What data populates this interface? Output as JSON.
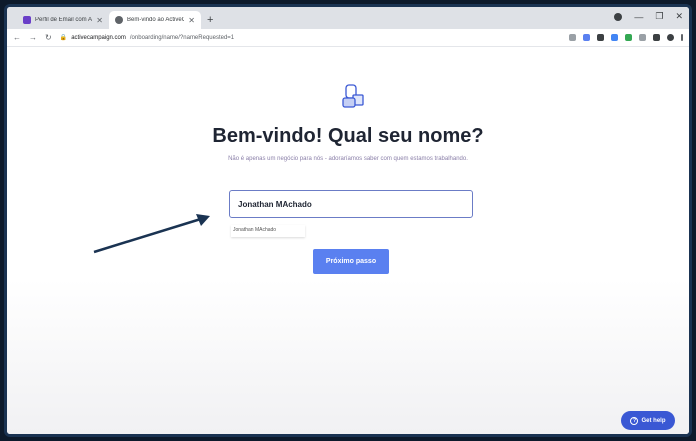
{
  "browser": {
    "tabs": [
      {
        "title": "Perfil de Email com ActiveCampai",
        "active": false,
        "favicon_color": "#6a3fc8"
      },
      {
        "title": "Bem-vindo ao ActiveCampaign",
        "active": true,
        "favicon_color": "#5f6368"
      }
    ],
    "new_tab": "+",
    "url_host": "activecampaign.com",
    "url_path": "/onboarding/name/?nameRequested=1"
  },
  "page": {
    "headline": "Bem-vindo! Qual seu nome?",
    "subtitle": "Não é apenas um negócio para nós - adoraríamos saber com quem estamos trabalhando.",
    "name_value": "Jonathan MAchado",
    "suggestion": "Jonathan MAchado",
    "next_button": "Próximo passo",
    "help_button": "Get help"
  },
  "colors": {
    "accent": "#5a80f0",
    "help": "#3a58d4",
    "headline": "#1f2533"
  }
}
